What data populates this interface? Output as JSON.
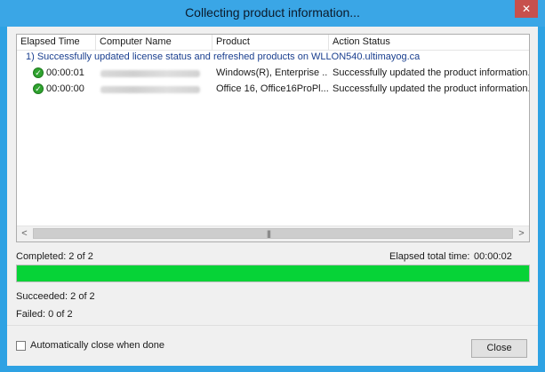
{
  "window": {
    "title": "Collecting product information...",
    "close_glyph": "✕"
  },
  "list": {
    "columns": [
      "Elapsed Time",
      "Computer Name",
      "Product",
      "Action Status"
    ],
    "group_header": "1) Successfully updated license status and refreshed products on WLLON540.ultimayog.ca",
    "rows": [
      {
        "status_icon": "success-check-icon",
        "elapsed": "00:00:01",
        "product": "Windows(R), Enterprise ...",
        "action_status": "Successfully updated the product information."
      },
      {
        "status_icon": "success-check-icon",
        "elapsed": "00:00:00",
        "product": "Office 16, Office16ProPl...",
        "action_status": "Successfully updated the product information."
      }
    ],
    "scroll_left": "<",
    "scroll_right": ">",
    "scroll_grip": "|||"
  },
  "progress": {
    "completed_label": "Completed: 2 of 2",
    "elapsed_total_label": "Elapsed total time:",
    "elapsed_total_value": "00:00:02",
    "fraction": 1.0,
    "fill_color": "#06d337"
  },
  "results": {
    "succeeded": "Succeeded: 2 of 2",
    "failed": "Failed: 0 of 2"
  },
  "footer": {
    "auto_close_label": "Automatically close when done",
    "auto_close_checked": false,
    "close_button": "Close"
  }
}
